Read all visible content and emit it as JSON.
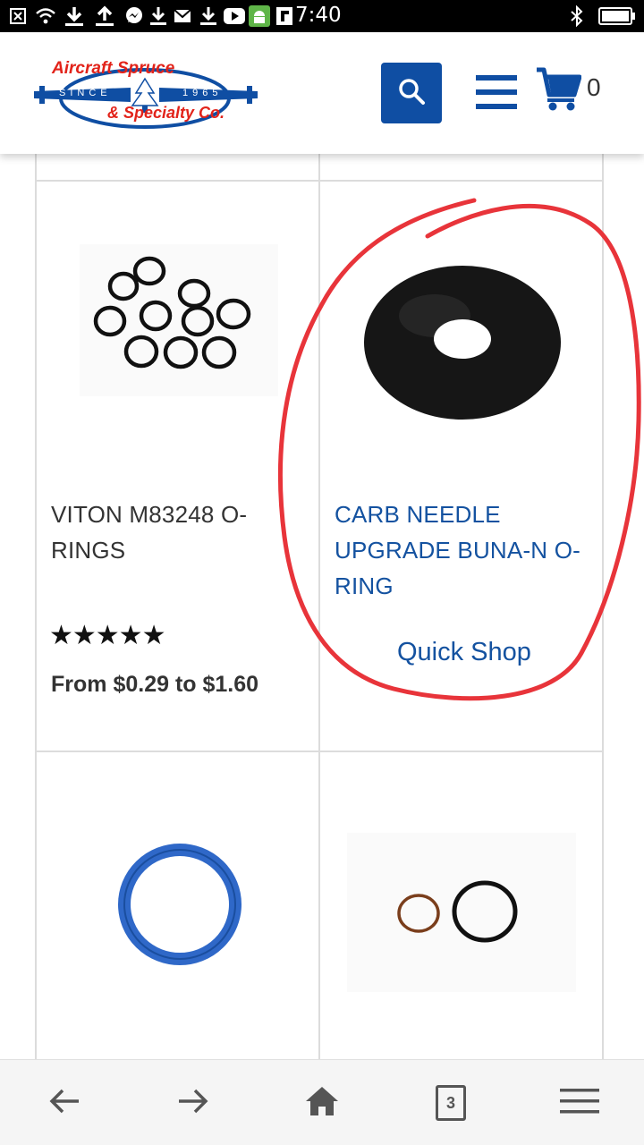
{
  "status_bar": {
    "time": "7:40",
    "icons": [
      "close-notification-icon",
      "wifi-icon",
      "download-icon",
      "upload-icon",
      "messenger-icon",
      "download-icon",
      "mail-icon",
      "download-icon",
      "youtube-icon",
      "android-icon",
      "flipboard-icon",
      "bluetooth-icon",
      "battery-icon"
    ]
  },
  "header": {
    "logo": {
      "line1": "Aircraft Spruce",
      "since": "SINCE",
      "year": "1965",
      "line2": "& Specialty Co."
    },
    "cart_count": "0"
  },
  "products": [
    {
      "name": "VITON M83248 O-RINGS",
      "rating": "★★★★★",
      "price": "From $0.29 to $1.60",
      "image": "multiple-black-o-rings"
    },
    {
      "name": "CARB NEEDLE UPGRADE BUNA-N O-RING",
      "quick_shop": "Quick Shop",
      "image": "single-black-o-ring"
    },
    {
      "image": "blue-o-ring"
    },
    {
      "image": "copper-and-black-o-rings"
    }
  ],
  "browser_nav": {
    "tab_count": "3"
  },
  "colors": {
    "brand_blue": "#0f4ea3",
    "link_blue": "#1452a0",
    "logo_red": "#e2231a",
    "annotation_red": "#e8343a"
  }
}
